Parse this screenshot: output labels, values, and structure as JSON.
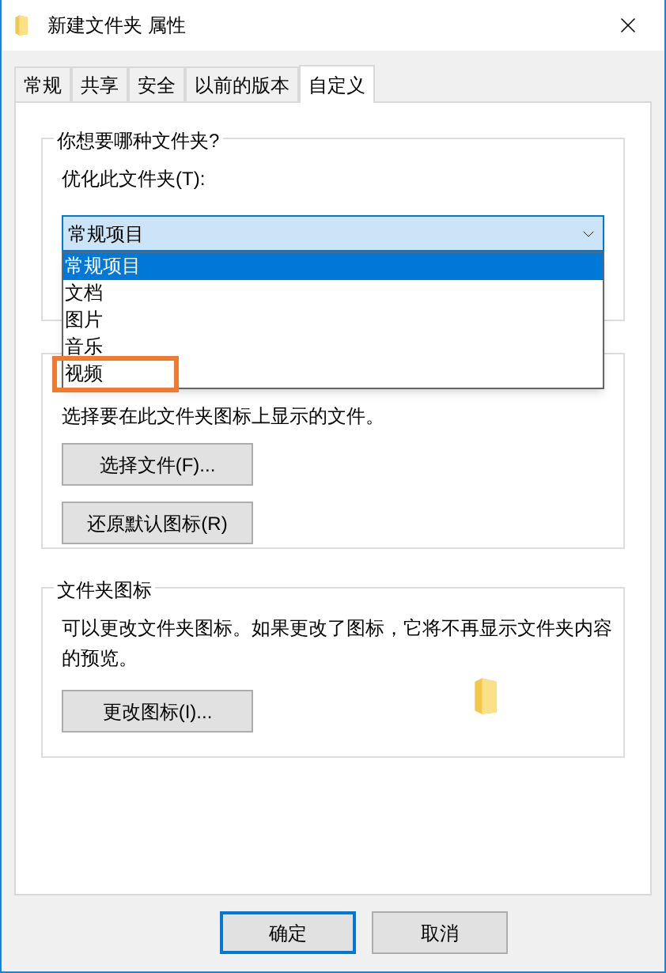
{
  "window": {
    "title": "新建文件夹 属性"
  },
  "tabs": [
    {
      "label": "常规",
      "selected": false
    },
    {
      "label": "共享",
      "selected": false
    },
    {
      "label": "安全",
      "selected": false
    },
    {
      "label": "以前的版本",
      "selected": false
    },
    {
      "label": "自定义",
      "selected": true
    }
  ],
  "folder_type": {
    "title": "你想要哪种文件夹?",
    "label": "优化此文件夹(T):",
    "value": "常规项目",
    "expanded": true,
    "options": [
      {
        "label": "常规项目",
        "selected": true,
        "annotated": false
      },
      {
        "label": "文档",
        "selected": false,
        "annotated": false
      },
      {
        "label": "图片",
        "selected": false,
        "annotated": false
      },
      {
        "label": "音乐",
        "selected": false,
        "annotated": false
      },
      {
        "label": "视频",
        "selected": false,
        "annotated": true
      }
    ]
  },
  "folder_picture": {
    "description": "选择要在此文件夹图标上显示的文件。",
    "buttons": [
      "选择文件(F)...",
      "还原默认图标(R)"
    ]
  },
  "folder_icon": {
    "title": "文件夹图标",
    "description": "可以更改文件夹图标。如果更改了图标，它将不再显示文件夹内容的预览。",
    "button": "更改图标(I)..."
  },
  "footer_buttons": [
    {
      "label": "确定",
      "default": true
    },
    {
      "label": "取消",
      "default": false
    }
  ]
}
